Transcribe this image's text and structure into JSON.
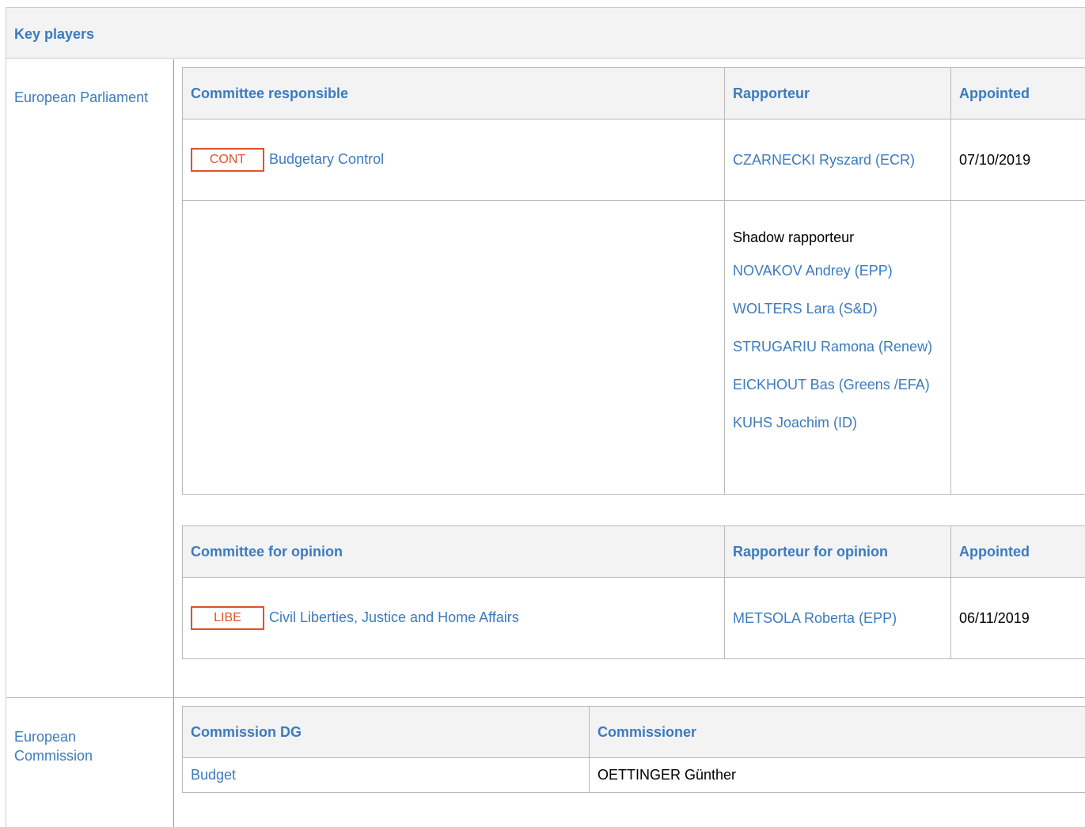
{
  "header": {
    "title": "Key players"
  },
  "ep": {
    "label": "European Parliament",
    "responsible": {
      "headers": [
        "Committee responsible",
        "Rapporteur",
        "Appointed"
      ],
      "committee_code": "CONT",
      "committee_name": "Budgetary Control",
      "rapporteur": "CZARNECKI Ryszard (ECR)",
      "appointed": "07/10/2019",
      "shadow_title": "Shadow rapporteur",
      "shadows": [
        "NOVAKOV Andrey (EPP)",
        "WOLTERS Lara (S&D)",
        "STRUGARIU Ramona (Renew)",
        "EICKHOUT Bas (Greens /EFA)",
        "KUHS Joachim (ID)"
      ]
    },
    "opinion": {
      "headers": [
        "Committee for opinion",
        "Rapporteur for opinion",
        "Appointed"
      ],
      "committee_code": "LIBE",
      "committee_name": "Civil Liberties, Justice and Home Affairs",
      "rapporteur": "METSOLA Roberta (EPP)",
      "appointed": "06/11/2019"
    }
  },
  "ec": {
    "label": "European Commission",
    "headers": [
      "Commission DG",
      "Commissioner"
    ],
    "dg": "Budget",
    "commissioner": "OETTINGER Günther"
  },
  "colors": {
    "link": "#3b7bbf",
    "badge": "#e0522b",
    "header_bg": "#f3f3f3"
  }
}
